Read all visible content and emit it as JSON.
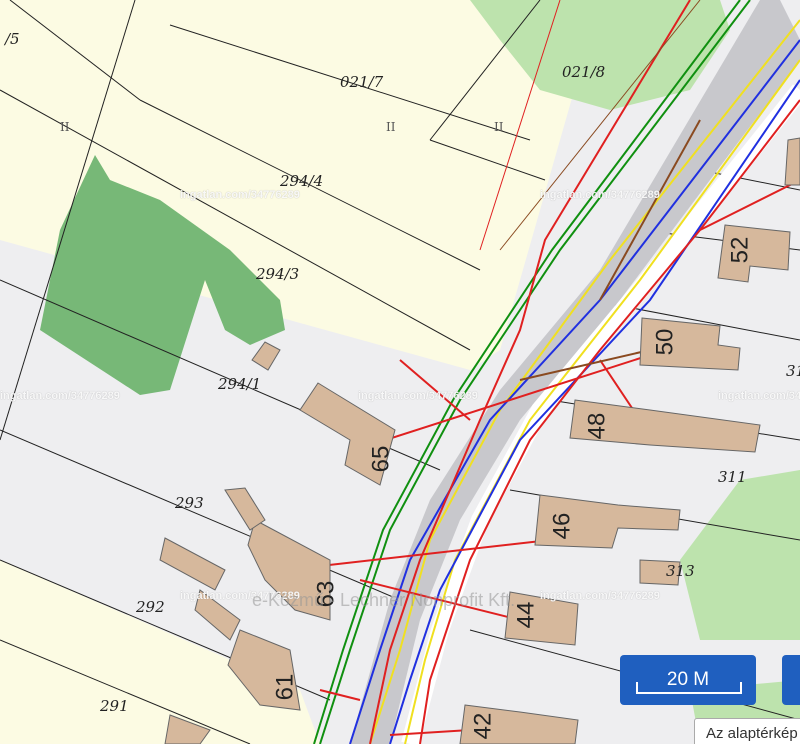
{
  "map": {
    "parcels": [
      {
        "id": "p1",
        "label": "/5"
      },
      {
        "id": "p2",
        "label": "021/7"
      },
      {
        "id": "p3",
        "label": "021/8"
      },
      {
        "id": "p4",
        "label": "294/4"
      },
      {
        "id": "p5",
        "label": "294/3"
      },
      {
        "id": "p6",
        "label": "294/1"
      },
      {
        "id": "p7",
        "label": "293"
      },
      {
        "id": "p8",
        "label": "292"
      },
      {
        "id": "p9",
        "label": "291"
      },
      {
        "id": "p10",
        "label": "311"
      },
      {
        "id": "p11",
        "label": "313"
      },
      {
        "id": "p12",
        "label": "31"
      }
    ],
    "marks": [
      {
        "id": "m1",
        "label": "II"
      },
      {
        "id": "m2",
        "label": "II"
      },
      {
        "id": "m3",
        "label": "II"
      }
    ],
    "house_numbers": [
      {
        "id": "h1",
        "label": "52"
      },
      {
        "id": "h2",
        "label": "50"
      },
      {
        "id": "h3",
        "label": "48"
      },
      {
        "id": "h4",
        "label": "46"
      },
      {
        "id": "h5",
        "label": "44"
      },
      {
        "id": "h6",
        "label": "42"
      },
      {
        "id": "h7",
        "label": "65"
      },
      {
        "id": "h8",
        "label": "63"
      },
      {
        "id": "h9",
        "label": "61"
      }
    ],
    "watermarks": [
      "ingatlan.com/34776289",
      "ingatlan.com/34776289",
      "ingatlan.com/34776289",
      "ingatlan.com/34776289",
      "ingatlan.com/34776289",
      "ingatlan.com/34776289",
      "ingatlan.com/34776289"
    ],
    "credit": "e-Közmű - Lechner Nonprofit Kft."
  },
  "controls": {
    "scale_label": "20 M",
    "base_layer_label": "Az alaptérkép"
  },
  "colors": {
    "background": "#eeeef0",
    "parcel_fill": "#fcfbe3",
    "green_area": "#a8d89a",
    "dark_green_area": "#77b877",
    "building": "#d6b89c",
    "road": "#c8c8cc",
    "pipe_red": "#e02020",
    "pipe_blue": "#2030e0",
    "pipe_yellow": "#f0e020",
    "pipe_green": "#109010",
    "button": "#1f5fbf"
  }
}
